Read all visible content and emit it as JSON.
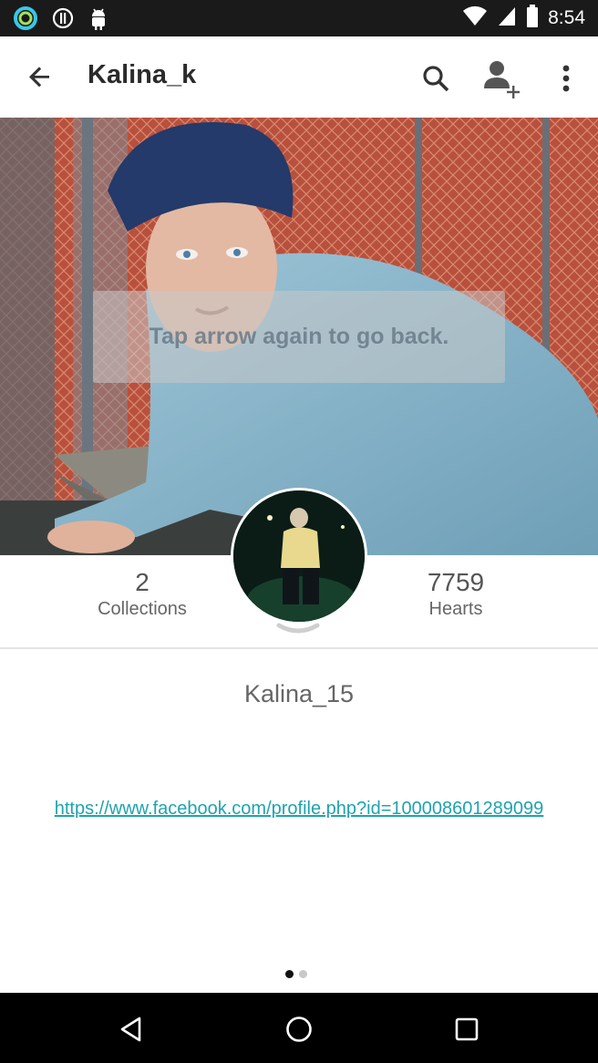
{
  "status_bar": {
    "time": "8:54",
    "left_icons": [
      "ring-app-icon",
      "info-circle-icon",
      "android-icon"
    ],
    "right_icons": [
      "wifi-icon",
      "signal-icon",
      "battery-icon"
    ]
  },
  "app_bar": {
    "title": "Kalina_k",
    "actions": [
      "search-icon",
      "add-person-icon",
      "more-vert-icon"
    ]
  },
  "cover": {
    "toast_text": "Tap arrow again to go back."
  },
  "stats": {
    "collections_count": "2",
    "collections_label": "Collections",
    "hearts_count": "7759",
    "hearts_label": "Hearts"
  },
  "profile": {
    "display_name": "Kalina_15",
    "link": "https://www.facebook.com/profile.php?id=100008601289099"
  },
  "pager": {
    "pages": 2,
    "active_index": 0
  },
  "colors": {
    "accent_link": "#1fa3b0",
    "status_bar": "#1a1a1a",
    "nav_bar": "#000000"
  }
}
